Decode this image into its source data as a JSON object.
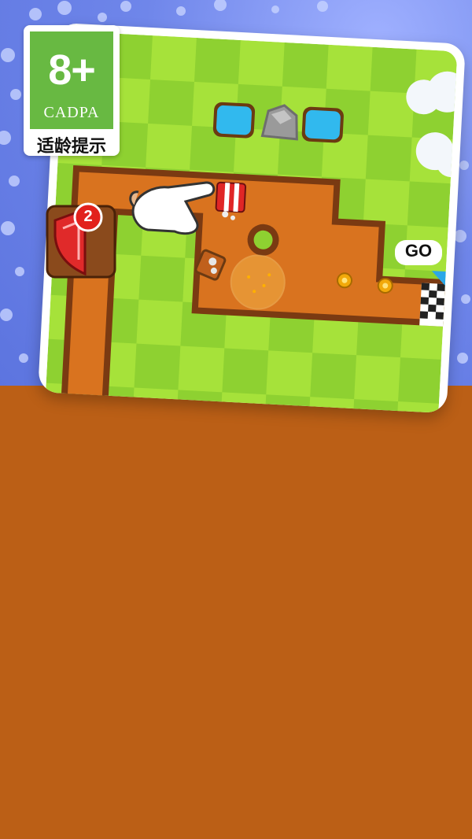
{
  "age_rating": {
    "rating": "8+",
    "organization": "CADPA",
    "notice": "适龄提示"
  },
  "level_badge": {
    "count": "2"
  },
  "goal_sign": {
    "label": "GO"
  },
  "colors": {
    "sky": "#6f86ea",
    "grass_light": "#a6e23a",
    "grass_dark": "#8ed131",
    "dirt": "#d9731f",
    "dirt_edge": "#7a3a12",
    "bottom_fill": "#bb5f16",
    "badge_red": "#e2211c"
  }
}
